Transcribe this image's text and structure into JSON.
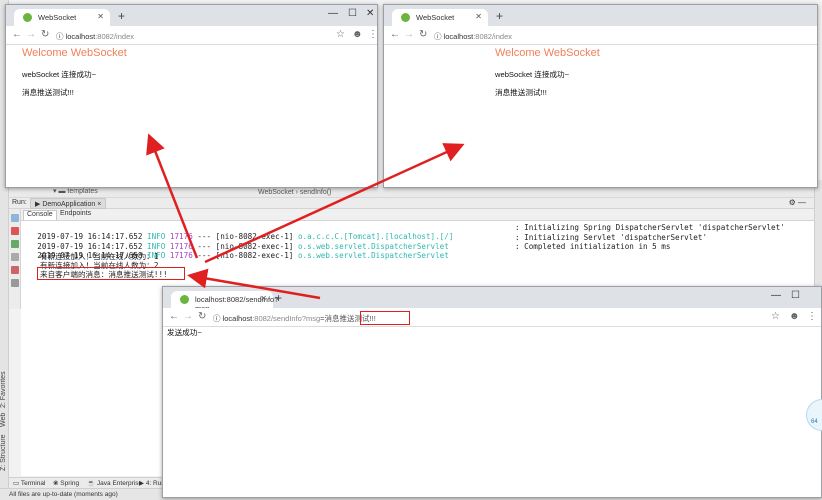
{
  "ide": {
    "templates_label": "templates",
    "breadcrumb": "WebSocket  ›  sendInfo()",
    "run_label": "Run:",
    "run_config": "DemoApplication",
    "console_tab": "Console",
    "endpoints_tab": "Endpoints",
    "left_vertical_tabs": [
      "2: Favorites",
      "Web",
      "Z: Structure"
    ],
    "log": [
      {
        "ts": "2019-07-19 16:14:17.652",
        "level": "INFO",
        "pid": "17176",
        "sep": "---",
        "thread": "[nio-8082-exec-1]",
        "cls": "o.a.c.c.C.[Tomcat].[localhost].[/]",
        "msg": ": Initializing Spring DispatcherServlet 'dispatcherServlet'"
      },
      {
        "ts": "2019-07-19 16:14:17.652",
        "level": "INFO",
        "pid": "17176",
        "sep": "---",
        "thread": "[nio-8082-exec-1]",
        "cls": "o.s.web.servlet.DispatcherServlet",
        "msg": ": Initializing Servlet 'dispatcherServlet'"
      },
      {
        "ts": "2019-07-19 16:14:17.658",
        "level": "INFO",
        "pid": "17176",
        "sep": "---",
        "thread": "[nio-8082-exec-1]",
        "cls": "o.s.web.servlet.DispatcherServlet",
        "msg": ": Completed initialization in 5 ms"
      }
    ],
    "plain_lines": [
      "有新连接加入！当前在线人数为：1",
      "有新连接加入！当前在线人数为：2",
      "来自客户端的消息：消息推送测试!!!"
    ],
    "bottom_tabs": [
      "Terminal",
      "Spring",
      "Java Enterprise",
      "4: Run"
    ],
    "status": "All files are up-to-date (moments ago)"
  },
  "browser1": {
    "tab_title": "WebSocket",
    "url_host": "localhost",
    "url_rest": ":8082/index",
    "heading": "Welcome WebSocket",
    "line1": "webSocket 连接成功~",
    "line2": "消息推送测试!!!"
  },
  "browser2": {
    "tab_title": "WebSocket",
    "url_host": "localhost",
    "url_rest": ":8082/index",
    "heading": "Welcome WebSocket",
    "line1": "webSocket 连接成功~",
    "line2": "消息推送测试!!!"
  },
  "browser3": {
    "tab_title": "localhost:8082/sendInfo?msg",
    "url_host": "localhost",
    "url_rest": ":8082/sendInfo?msg",
    "url_param": "=消息推送测试!!!",
    "body_text": "发送成功~"
  },
  "side_badge": "64"
}
